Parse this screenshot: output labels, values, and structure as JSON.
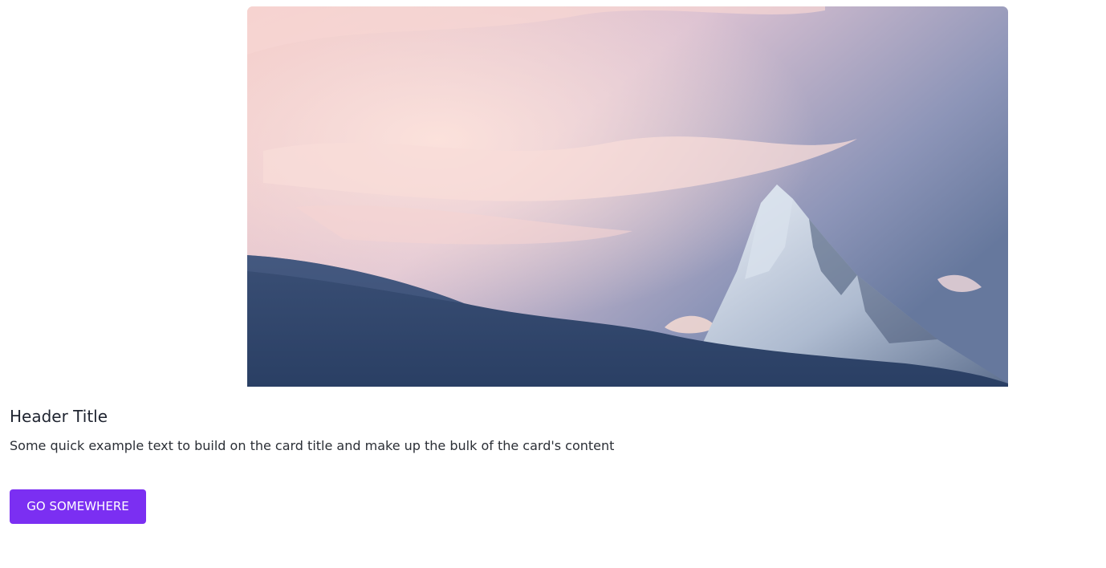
{
  "card": {
    "image_description_icon": "mountain-peak-image",
    "title": "Header Title",
    "text": "Some quick example text to build on the card title and make up the bulk of the card's content",
    "button_label": "GO SOMEWHERE"
  },
  "colors": {
    "button_background": "#7b2ff2",
    "button_text": "#ffffff",
    "page_background": "#ffffff"
  }
}
